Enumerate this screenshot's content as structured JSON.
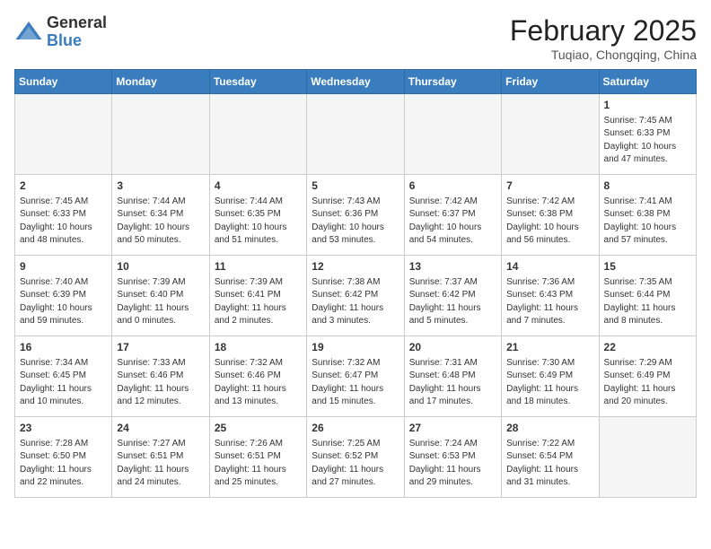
{
  "header": {
    "logo": {
      "general": "General",
      "blue": "Blue"
    },
    "title": "February 2025",
    "location": "Tuqiao, Chongqing, China"
  },
  "calendar": {
    "days_of_week": [
      "Sunday",
      "Monday",
      "Tuesday",
      "Wednesday",
      "Thursday",
      "Friday",
      "Saturday"
    ],
    "weeks": [
      [
        {
          "day": "",
          "info": ""
        },
        {
          "day": "",
          "info": ""
        },
        {
          "day": "",
          "info": ""
        },
        {
          "day": "",
          "info": ""
        },
        {
          "day": "",
          "info": ""
        },
        {
          "day": "",
          "info": ""
        },
        {
          "day": "1",
          "info": "Sunrise: 7:45 AM\nSunset: 6:33 PM\nDaylight: 10 hours and 47 minutes."
        }
      ],
      [
        {
          "day": "2",
          "info": "Sunrise: 7:45 AM\nSunset: 6:33 PM\nDaylight: 10 hours and 48 minutes."
        },
        {
          "day": "3",
          "info": "Sunrise: 7:44 AM\nSunset: 6:34 PM\nDaylight: 10 hours and 50 minutes."
        },
        {
          "day": "4",
          "info": "Sunrise: 7:44 AM\nSunset: 6:35 PM\nDaylight: 10 hours and 51 minutes."
        },
        {
          "day": "5",
          "info": "Sunrise: 7:43 AM\nSunset: 6:36 PM\nDaylight: 10 hours and 53 minutes."
        },
        {
          "day": "6",
          "info": "Sunrise: 7:42 AM\nSunset: 6:37 PM\nDaylight: 10 hours and 54 minutes."
        },
        {
          "day": "7",
          "info": "Sunrise: 7:42 AM\nSunset: 6:38 PM\nDaylight: 10 hours and 56 minutes."
        },
        {
          "day": "8",
          "info": "Sunrise: 7:41 AM\nSunset: 6:38 PM\nDaylight: 10 hours and 57 minutes."
        }
      ],
      [
        {
          "day": "9",
          "info": "Sunrise: 7:40 AM\nSunset: 6:39 PM\nDaylight: 10 hours and 59 minutes."
        },
        {
          "day": "10",
          "info": "Sunrise: 7:39 AM\nSunset: 6:40 PM\nDaylight: 11 hours and 0 minutes."
        },
        {
          "day": "11",
          "info": "Sunrise: 7:39 AM\nSunset: 6:41 PM\nDaylight: 11 hours and 2 minutes."
        },
        {
          "day": "12",
          "info": "Sunrise: 7:38 AM\nSunset: 6:42 PM\nDaylight: 11 hours and 3 minutes."
        },
        {
          "day": "13",
          "info": "Sunrise: 7:37 AM\nSunset: 6:42 PM\nDaylight: 11 hours and 5 minutes."
        },
        {
          "day": "14",
          "info": "Sunrise: 7:36 AM\nSunset: 6:43 PM\nDaylight: 11 hours and 7 minutes."
        },
        {
          "day": "15",
          "info": "Sunrise: 7:35 AM\nSunset: 6:44 PM\nDaylight: 11 hours and 8 minutes."
        }
      ],
      [
        {
          "day": "16",
          "info": "Sunrise: 7:34 AM\nSunset: 6:45 PM\nDaylight: 11 hours and 10 minutes."
        },
        {
          "day": "17",
          "info": "Sunrise: 7:33 AM\nSunset: 6:46 PM\nDaylight: 11 hours and 12 minutes."
        },
        {
          "day": "18",
          "info": "Sunrise: 7:32 AM\nSunset: 6:46 PM\nDaylight: 11 hours and 13 minutes."
        },
        {
          "day": "19",
          "info": "Sunrise: 7:32 AM\nSunset: 6:47 PM\nDaylight: 11 hours and 15 minutes."
        },
        {
          "day": "20",
          "info": "Sunrise: 7:31 AM\nSunset: 6:48 PM\nDaylight: 11 hours and 17 minutes."
        },
        {
          "day": "21",
          "info": "Sunrise: 7:30 AM\nSunset: 6:49 PM\nDaylight: 11 hours and 18 minutes."
        },
        {
          "day": "22",
          "info": "Sunrise: 7:29 AM\nSunset: 6:49 PM\nDaylight: 11 hours and 20 minutes."
        }
      ],
      [
        {
          "day": "23",
          "info": "Sunrise: 7:28 AM\nSunset: 6:50 PM\nDaylight: 11 hours and 22 minutes."
        },
        {
          "day": "24",
          "info": "Sunrise: 7:27 AM\nSunset: 6:51 PM\nDaylight: 11 hours and 24 minutes."
        },
        {
          "day": "25",
          "info": "Sunrise: 7:26 AM\nSunset: 6:51 PM\nDaylight: 11 hours and 25 minutes."
        },
        {
          "day": "26",
          "info": "Sunrise: 7:25 AM\nSunset: 6:52 PM\nDaylight: 11 hours and 27 minutes."
        },
        {
          "day": "27",
          "info": "Sunrise: 7:24 AM\nSunset: 6:53 PM\nDaylight: 11 hours and 29 minutes."
        },
        {
          "day": "28",
          "info": "Sunrise: 7:22 AM\nSunset: 6:54 PM\nDaylight: 11 hours and 31 minutes."
        },
        {
          "day": "",
          "info": ""
        }
      ]
    ]
  }
}
